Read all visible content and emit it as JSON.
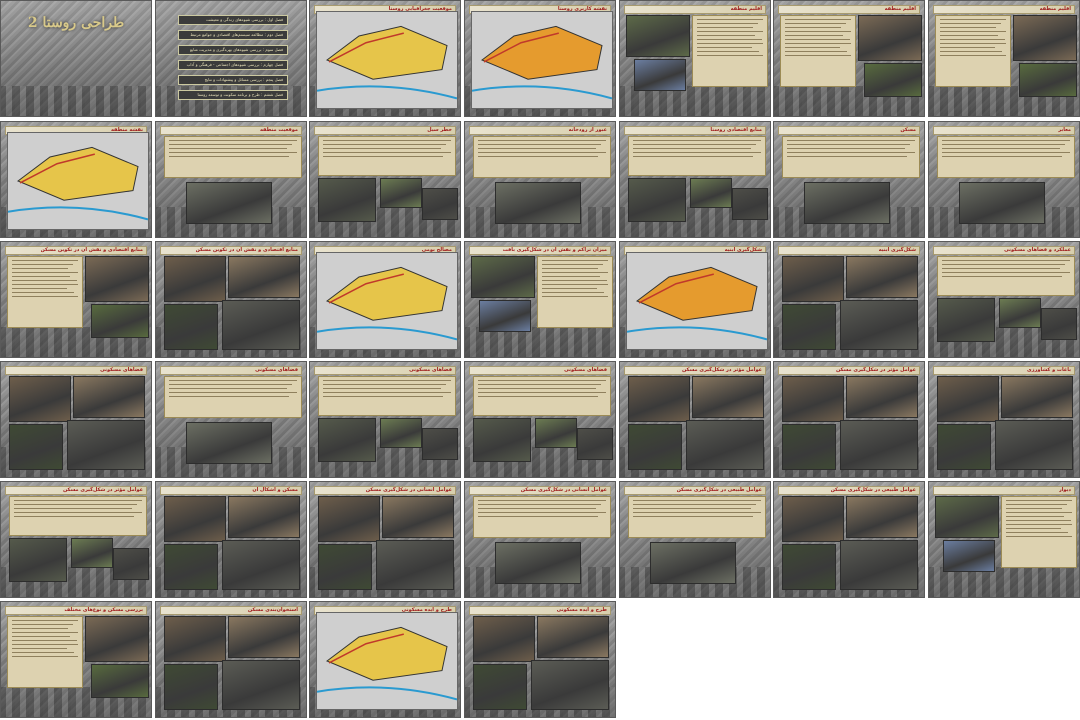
{
  "slides": [
    {
      "title": "طراحی روستا 2"
    },
    {
      "title": "",
      "buttons": [
        "فصل اول : بررسی شیوه‌های زندگی و معیشت",
        "فصل دوم : مطالعه سیستم‌های اقتصادی و جوامع مرتبط",
        "فصل سوم : بررسی شیوه‌های بهره‌گیری و مدیریت منابع",
        "فصل چهارم : بررسی شیوه‌های اجتماعی - فرهنگی و آداب",
        "فصل پنجم : بررسی مسائل و پیشنهادات و نتایج",
        "فصل ششم : طرح و برنامه سکونت و توسعه روستا"
      ]
    },
    {
      "title": "موقعیت جغرافیایی روستا"
    },
    {
      "title": "نقشه کاربری روستا"
    },
    {
      "title": "اقلیم منطقه"
    },
    {
      "title": "اقلیم منطقه"
    },
    {
      "title": "اقلیم منطقه"
    },
    {
      "title": "نقشه منطقه"
    },
    {
      "title": "موقعیت منطقه"
    },
    {
      "title": "خطر سیل"
    },
    {
      "title": "عبور از رودخانه"
    },
    {
      "title": "منابع اقتصادی روستا"
    },
    {
      "title": "مسکن"
    },
    {
      "title": "معابر"
    },
    {
      "title": "منابع اقتصادی و نقش آن در تکوین مسکن"
    },
    {
      "title": "منابع اقتصادی و نقش آن در تکوین مسکن"
    },
    {
      "title": "مصالح بومی"
    },
    {
      "title": "میزان تراکم و نقش آن در شکل‌گیری بافت"
    },
    {
      "title": "شکل‌گیری ابنیه"
    },
    {
      "title": "شکل‌گیری ابنیه"
    },
    {
      "title": "عملکرد و فضاهای مسکونی"
    },
    {
      "title": "فضاهای مسکونی"
    },
    {
      "title": "فضاهای مسکونی"
    },
    {
      "title": "فضاهای مسکونی"
    },
    {
      "title": "فضاهای مسکونی"
    },
    {
      "title": "عوامل مؤثر در شکل‌گیری مسکن"
    },
    {
      "title": "عوامل مؤثر در شکل‌گیری مسکن"
    },
    {
      "title": "باغات و کشاورزی"
    },
    {
      "title": "عوامل مؤثر در شکل‌گیری مسکن"
    },
    {
      "title": "مسکن و اشکال آن"
    },
    {
      "title": "عوامل انسانی در شکل‌گیری مسکن"
    },
    {
      "title": "عوامل انسانی در شکل‌گیری مسکن"
    },
    {
      "title": "عوامل طبیعی در شکل‌گیری مسکن"
    },
    {
      "title": "عوامل طبیعی در شکل‌گیری مسکن"
    },
    {
      "title": "دیوار"
    },
    {
      "title": "بررسی مسکن و نوع‌های مختلف"
    },
    {
      "title": "استخوان‌بندی مسکن"
    },
    {
      "title": "طرح و ایده مسکونی"
    },
    {
      "title": "طرح و ایده مسکونی"
    }
  ],
  "colors": {
    "title_red": "#b01515",
    "textbox": "#ddd2b0",
    "cover_title": "#d8c98a"
  }
}
